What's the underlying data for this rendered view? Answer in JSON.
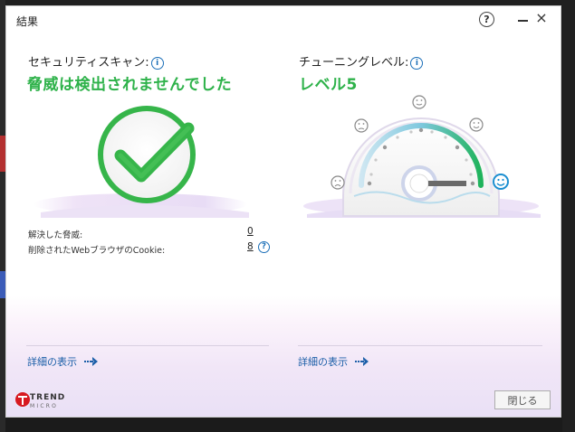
{
  "window": {
    "title": "結果"
  },
  "security": {
    "heading": "セキュリティスキャン:",
    "status": "脅威は検出されませんでした",
    "rows": [
      {
        "label": "解決した脅威:",
        "value": "0"
      },
      {
        "label": "削除されたWebブラウザのCookie:",
        "value": "8"
      }
    ],
    "detail_link": "詳細の表示"
  },
  "tuning": {
    "heading": "チューニングレベル:",
    "level": "レベル5",
    "detail_link": "詳細の表示"
  },
  "footer": {
    "logo_line1": "TREND",
    "logo_line2": "MICRO",
    "close_label": "閉じる"
  },
  "icons": {
    "help": "?",
    "info": "i",
    "minimize": "minimize-icon",
    "close": "×"
  },
  "colors": {
    "accent_green": "#2eb24a",
    "link_blue": "#1c5fa8",
    "brand_red": "#d71920"
  }
}
